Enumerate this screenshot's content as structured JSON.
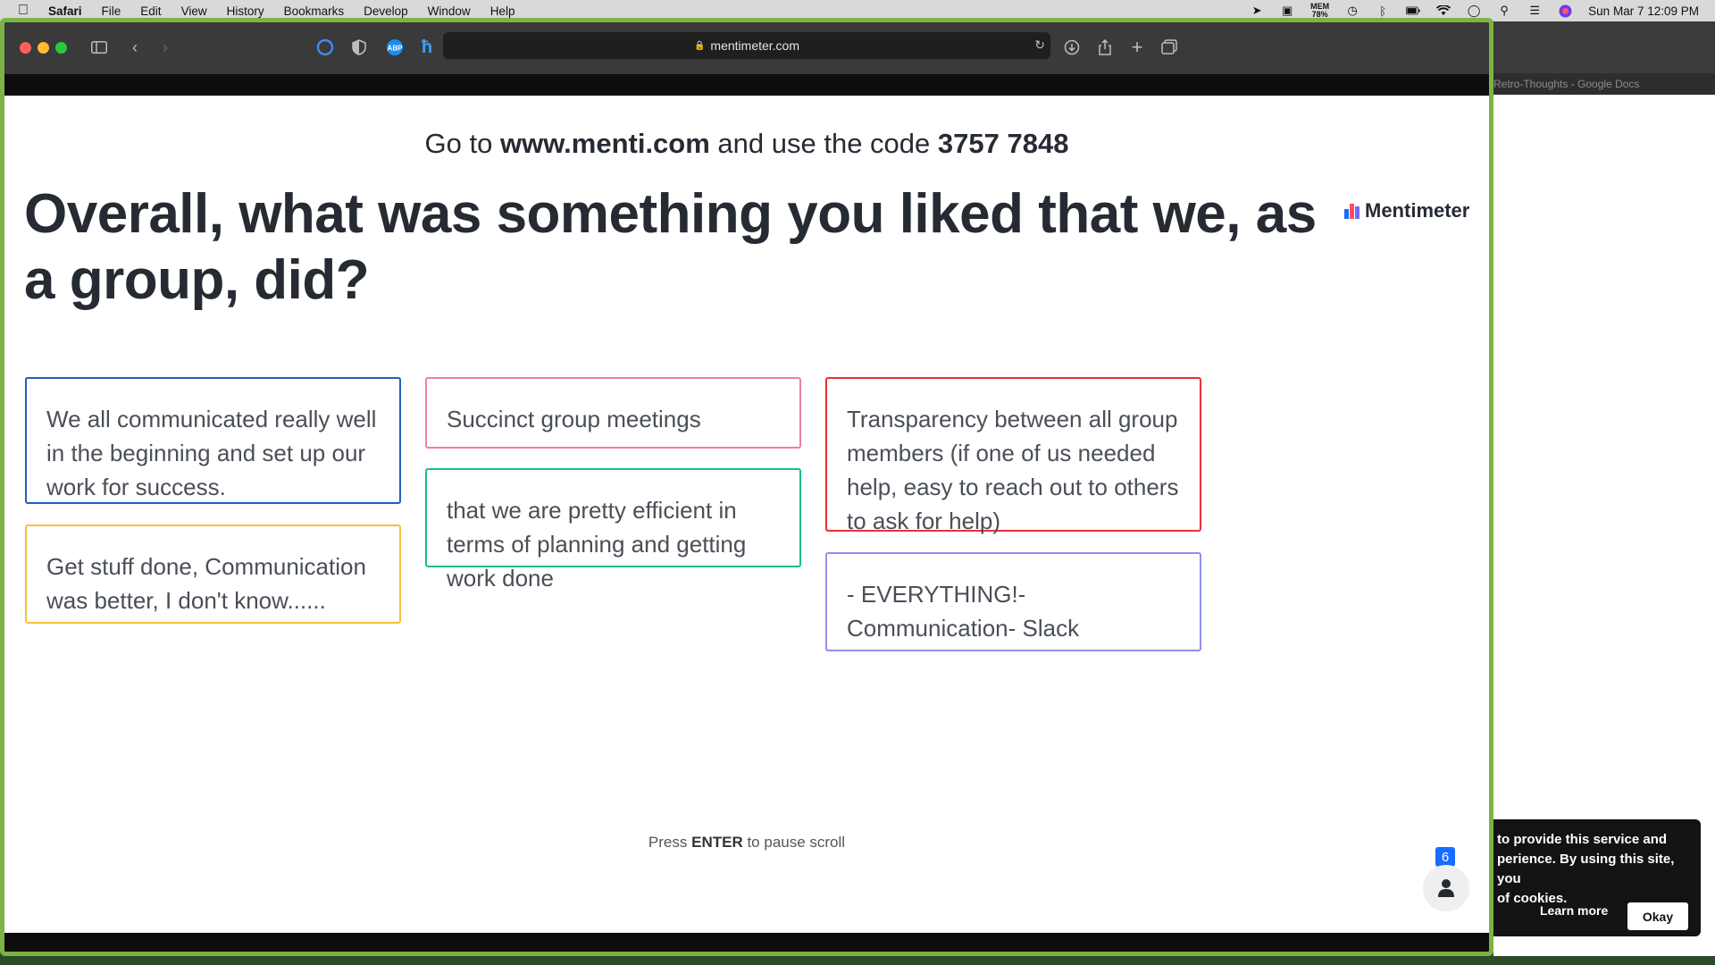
{
  "menubar": {
    "app": "Safari",
    "items": [
      "File",
      "Edit",
      "View",
      "History",
      "Bookmarks",
      "Develop",
      "Window",
      "Help"
    ],
    "mem_label": "MEM",
    "mem_value": "78%",
    "datetime": "Sun Mar 7  12:09 PM"
  },
  "browser": {
    "url": "mentimeter.com",
    "background_tab": "Retro-Thoughts - Google Docs"
  },
  "page": {
    "instruction_prefix": "Go to ",
    "instruction_site": "www.menti.com",
    "instruction_middle": " and use the code ",
    "instruction_code": "3757 7848",
    "question": "Overall, what was something you liked that we, as a group, did?",
    "brand": "Mentimeter",
    "responses": [
      {
        "text": "We all communicated really well in the beginning and set up our work for success.",
        "color": "#1f5fbf"
      },
      {
        "text": "Get stuff done, Communication was better, I don't know......",
        "color": "#f5bf42"
      },
      {
        "text": "Succinct group meetings",
        "color": "#ef7fa0"
      },
      {
        "text": "that we are pretty efficient in terms of planning and getting work done",
        "color": "#1dbb8a"
      },
      {
        "text": "Transparency between all group members (if one of us needed help, easy to reach out to others to ask for help)",
        "color": "#e8303c"
      },
      {
        "text": "- EVERYTHING!- Communication- Slack",
        "color": "#8f8ff0"
      }
    ],
    "press_prefix": "Press ",
    "press_key": "ENTER",
    "press_suffix": " to pause scroll",
    "participant_count": "6"
  },
  "cookie": {
    "text": "to provide this service and\nperience. By using this site, you\nof cookies.",
    "learn_more": "Learn more",
    "okay": "Okay"
  },
  "colors": {
    "window_border": "#7cb342",
    "accent_blue": "#196cff"
  }
}
